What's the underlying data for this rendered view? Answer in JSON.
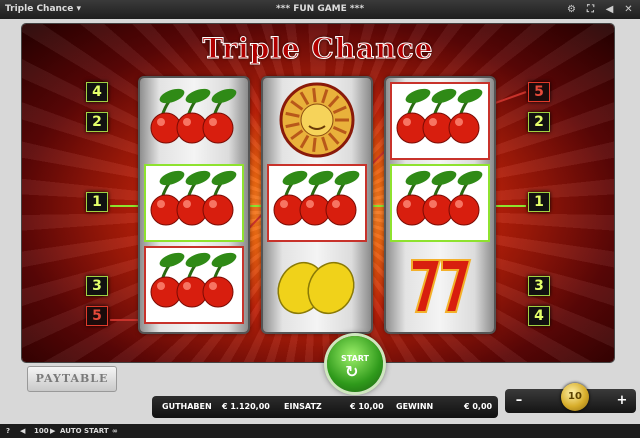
{
  "window": {
    "game_name": "Triple Chance",
    "mode_label": "*** FUN GAME ***"
  },
  "title": "Triple Chance",
  "line_numbers": {
    "left": [
      {
        "n": "4",
        "color": "green"
      },
      {
        "n": "2",
        "color": "green"
      },
      {
        "n": "1",
        "color": "green"
      },
      {
        "n": "3",
        "color": "green"
      },
      {
        "n": "5",
        "color": "red"
      }
    ],
    "right": [
      {
        "n": "5",
        "color": "red"
      },
      {
        "n": "2",
        "color": "green"
      },
      {
        "n": "1",
        "color": "green"
      },
      {
        "n": "3",
        "color": "green"
      },
      {
        "n": "4",
        "color": "green"
      }
    ]
  },
  "reels": [
    [
      "cherry",
      "cherry",
      "cherry"
    ],
    [
      "sun",
      "cherry",
      "lemon"
    ],
    [
      "cherry",
      "cherry",
      "seven"
    ]
  ],
  "buttons": {
    "paytable": "PAYTABLE",
    "start": "START"
  },
  "status": {
    "balance_label": "GUTHABEN",
    "balance_value": "€ 1.120,00",
    "bet_label": "EINSATZ",
    "bet_value": "€ 10,00",
    "win_label": "GEWINN",
    "win_value": "€ 0,00"
  },
  "stake": {
    "minus": "–",
    "coin_value": "10",
    "plus": "+"
  },
  "footer": {
    "help": "?",
    "autostart_count": "100",
    "autostart_label": "AUTO START"
  },
  "colors": {
    "line_green": "#8ee22f",
    "line_red": "#c8322b",
    "start_green": "#2f9a1b"
  }
}
